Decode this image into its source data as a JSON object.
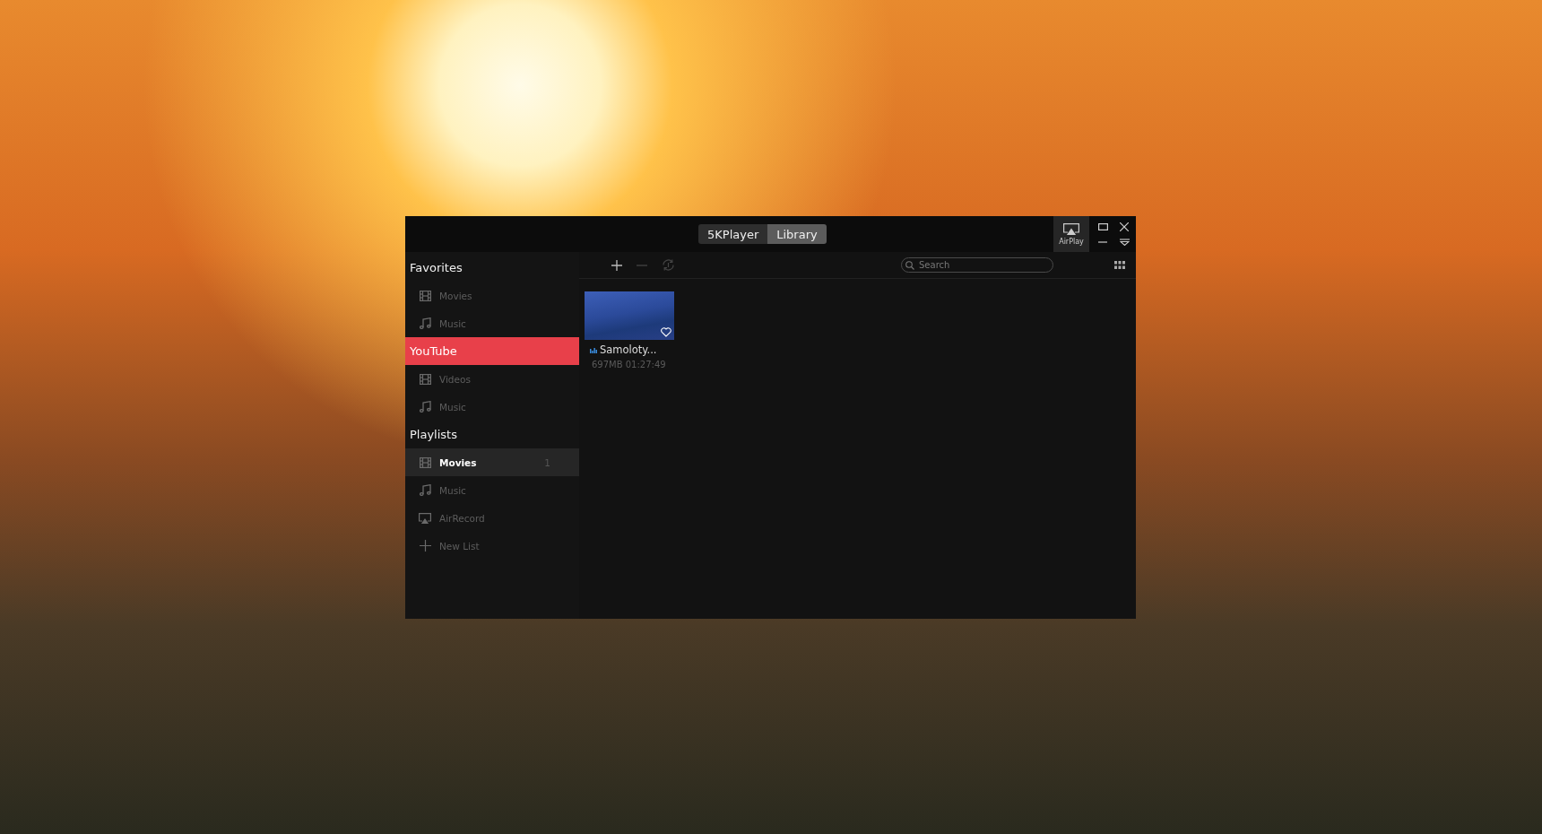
{
  "window": {
    "tabs": [
      {
        "label": "5KPlayer",
        "selected": false
      },
      {
        "label": "Library",
        "selected": true
      }
    ],
    "airplay_label": "AirPlay"
  },
  "sidebar": {
    "sections": [
      {
        "title": "Favorites",
        "selected": false,
        "items": [
          {
            "kind": "film",
            "label": "Movies",
            "selected": false
          },
          {
            "kind": "music",
            "label": "Music",
            "selected": false
          }
        ]
      },
      {
        "title": "YouTube",
        "selected": true,
        "items": [
          {
            "kind": "film",
            "label": "Videos",
            "selected": false
          },
          {
            "kind": "music",
            "label": "Music",
            "selected": false
          }
        ]
      },
      {
        "title": "Playlists",
        "selected": false,
        "items": [
          {
            "kind": "film",
            "label": "Movies",
            "selected": true,
            "count": "1"
          },
          {
            "kind": "music",
            "label": "Music",
            "selected": false
          },
          {
            "kind": "airplay",
            "label": "AirRecord",
            "selected": false
          },
          {
            "kind": "plus",
            "label": "New List",
            "selected": false
          }
        ]
      }
    ]
  },
  "toolbar": {
    "search": {
      "placeholder": "Search"
    }
  },
  "media": [
    {
      "title": "Samoloty...",
      "info": "697MB 01:27:49",
      "favorite": false
    }
  ]
}
